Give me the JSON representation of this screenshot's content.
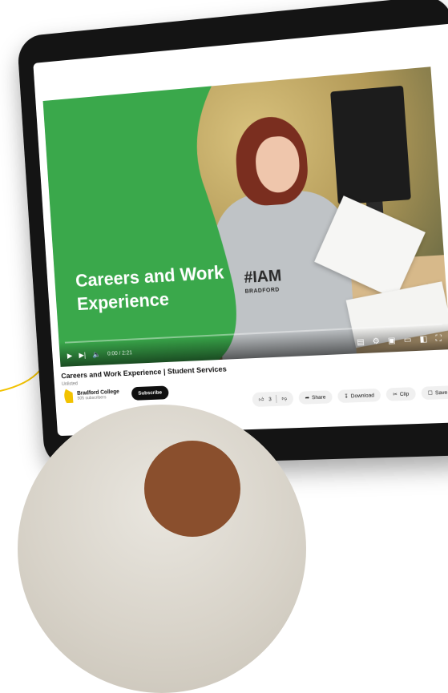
{
  "video": {
    "overlay_title": "Careers and Work Experience",
    "hoodie_text": "#IAM",
    "hoodie_sub": "BRADFORD",
    "time": "0:00 / 2:21",
    "colors": {
      "brand_green": "#3aa84b",
      "hoodie": "#bfc3c6"
    }
  },
  "page": {
    "title": "Careers and Work Experience | Student Services",
    "visibility": "Unlisted"
  },
  "channel": {
    "name": "Bradford College",
    "subscribers": "505 subscribers",
    "subscribe_label": "Subscribe"
  },
  "actions": {
    "like_count": "3",
    "share_label": "Share",
    "download_label": "Download",
    "clip_label": "Clip",
    "save_label": "Save",
    "more_label": "..."
  },
  "icons": {
    "play": "play-icon",
    "next": "next-icon",
    "volume": "volume-icon",
    "subtitles": "subtitles-icon",
    "settings": "gear-icon",
    "miniplayer": "miniplayer-icon",
    "theater": "theater-icon",
    "cast": "cast-icon",
    "fullscreen": "fullscreen-icon"
  }
}
